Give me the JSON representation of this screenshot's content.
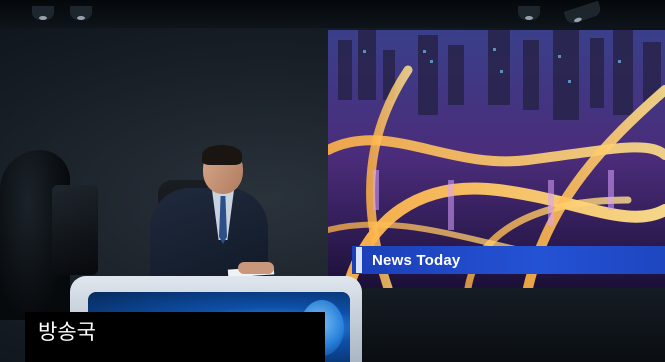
{
  "scene": {
    "description_icons": [
      "studio-light-icon",
      "tv-camera-icon"
    ]
  },
  "videowall": {
    "ticker_title": "News Today",
    "ticker_color": "#2452d4"
  },
  "caption": {
    "text": "방송국"
  }
}
